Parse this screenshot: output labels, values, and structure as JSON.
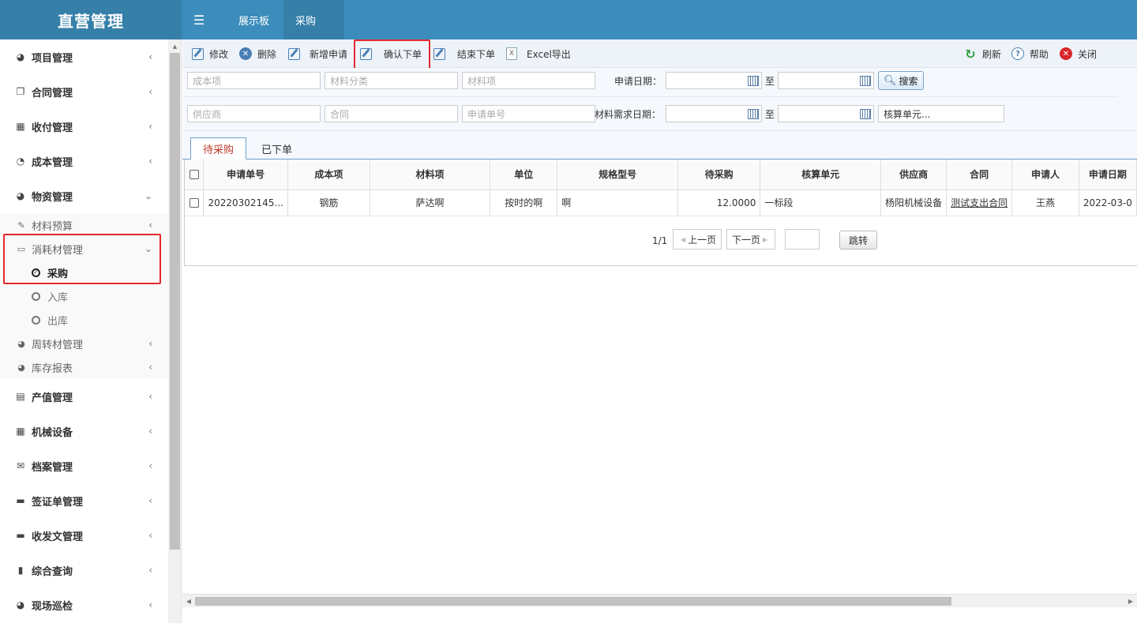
{
  "app": {
    "title": "直营管理"
  },
  "topnav": {
    "menu_icon": "hamburger-icon",
    "tabs": [
      "展示板",
      "采购"
    ]
  },
  "sidebar": {
    "items": [
      {
        "label": "项目管理",
        "icon": "dashboard-icon"
      },
      {
        "label": "合同管理",
        "icon": "copy-icon"
      },
      {
        "label": "收付管理",
        "icon": "grid-icon"
      },
      {
        "label": "成本管理",
        "icon": "pie-chart-icon"
      },
      {
        "label": "物资管理",
        "icon": "dashboard-icon"
      }
    ],
    "sub_items": [
      {
        "label": "材料预算",
        "icon": "edit-icon"
      },
      {
        "label": "消耗材管理",
        "icon": "laptop-icon"
      },
      {
        "label": "周转材管理",
        "icon": "dashboard-icon"
      },
      {
        "label": "库存报表",
        "icon": "dashboard-icon"
      }
    ],
    "leaves": [
      {
        "label": "采购",
        "active": true
      },
      {
        "label": "入库"
      },
      {
        "label": "出库"
      }
    ],
    "bottom_items": [
      {
        "label": "产值管理",
        "icon": "table-icon"
      },
      {
        "label": "机械设备",
        "icon": "calendar-icon"
      },
      {
        "label": "档案管理",
        "icon": "envelope-icon"
      },
      {
        "label": "签证单管理",
        "icon": "folder-icon"
      },
      {
        "label": "收发文管理",
        "icon": "folder-icon"
      },
      {
        "label": "综合查询",
        "icon": "book-icon"
      },
      {
        "label": "现场巡检",
        "icon": "dashboard-icon"
      }
    ]
  },
  "toolbar": {
    "edit": "修改",
    "delete": "删除",
    "add": "新增申请",
    "confirm": "确认下单",
    "finish": "结束下单",
    "export": "Excel导出",
    "refresh": "刷新",
    "help": "帮助",
    "close": "关闭"
  },
  "filters": {
    "cost_item": "成本项",
    "material_category": "材料分类",
    "material_item": "材料项",
    "apply_date_label": "申请日期：",
    "to": "至",
    "search": "搜索",
    "supplier": "供应商",
    "contract": "合同",
    "apply_no": "申请单号",
    "need_date_label": "材料需求日期：",
    "accounting_unit": "核算单元..."
  },
  "tabs": [
    "待采购",
    "已下单"
  ],
  "table": {
    "columns": [
      "申请单号",
      "成本项",
      "材料项",
      "单位",
      "规格型号",
      "待采购",
      "核算单元",
      "供应商",
      "合同",
      "申请人",
      "申请日期"
    ],
    "rows": [
      [
        "20220302145...",
        "钢筋",
        "萨达啊",
        "按时的啊",
        "啊",
        "12.0000",
        "一标段",
        "杨阳机械设备",
        "测试支出合同",
        "王燕",
        "2022-03-0"
      ]
    ]
  },
  "pager": {
    "info": "1/1",
    "prev": "上一页",
    "next": "下一页",
    "go": "跳转"
  },
  "colors": {
    "header": "#3c8dbc",
    "logo": "#367fa9",
    "highlight": "#e3292c",
    "active_tab": "#c0392b"
  }
}
